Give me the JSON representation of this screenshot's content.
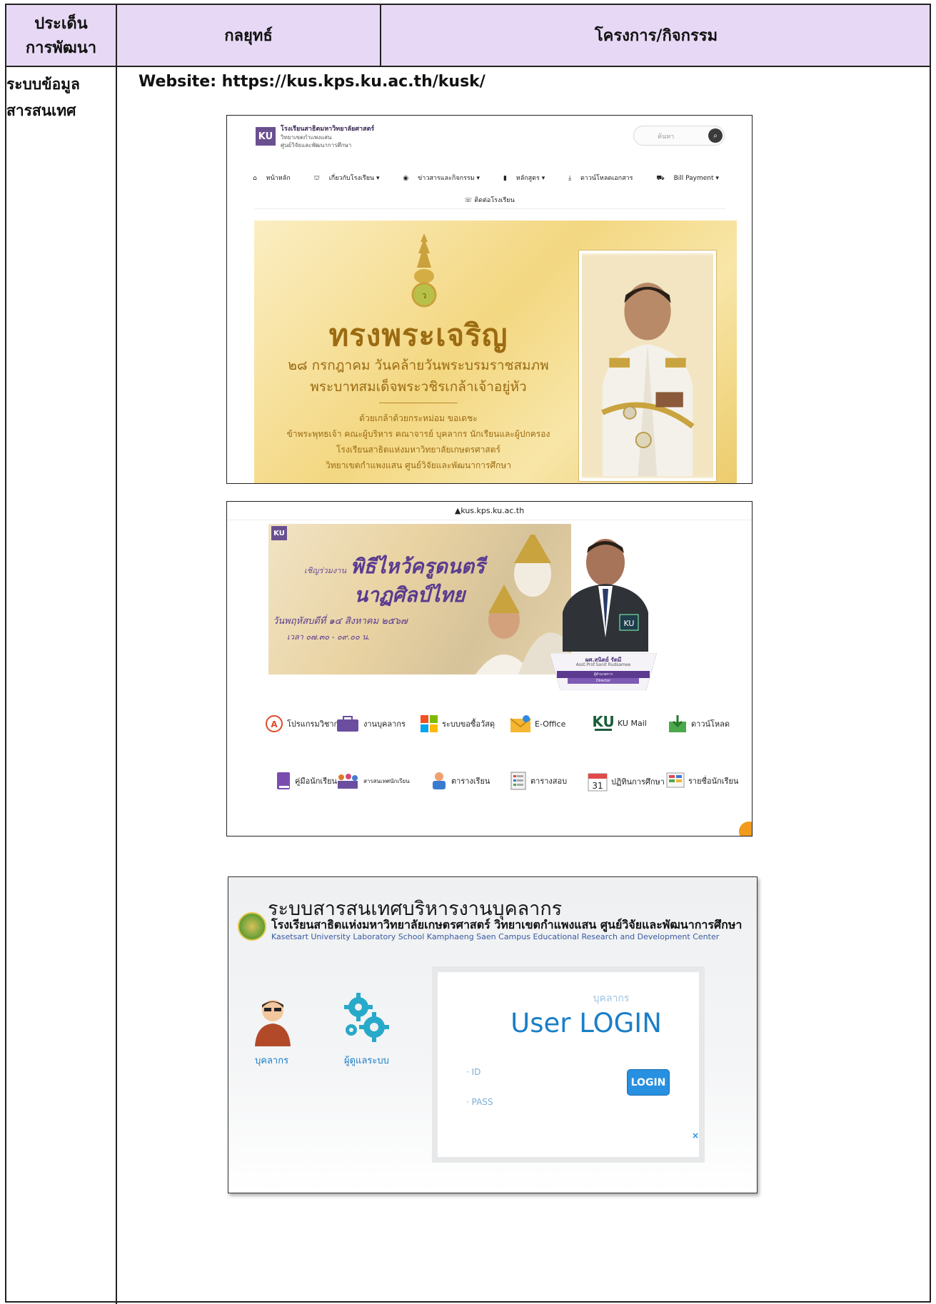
{
  "table": {
    "headers": [
      "ประเด็น\nการพัฒนา",
      "กลยุทธ์",
      "โครงการ/กิจกรรม"
    ],
    "row_label": "ระบบข้อมูล\nสารสนเทศ",
    "website": "Website: https://kus.kps.ku.ac.th/kusk/",
    "header_bg": "#e7d9f5"
  },
  "shot1": {
    "logo": "KU",
    "school_line1": "โรงเรียนสาธิตมหาวิทยาลัยศาสตร์",
    "school_line2": "วิทยาเขตกำแพงแสน",
    "school_line3": "ศูนย์วิจัยและพัฒนาการศึกษา",
    "search_placeholder": "ค้นหา",
    "nav": [
      "หน้าหลัก",
      "เกี่ยวกับโรงเรียน ▾",
      "ข่าวสารและกิจกรรม ▾",
      "หลักสูตร ▾",
      "ดาวน์โหลดเอกสาร",
      "Bill Payment ▾"
    ],
    "nav2": "ติดต่อโรงเรียน",
    "banner_title": "ทรงพระเจริญ",
    "banner_line2": "๒๘ กรกฎาคม วันคล้ายวันพระบรมราชสมภพ",
    "banner_line3": "พระบาทสมเด็จพระวชิรเกล้าเจ้าอยู่หัว",
    "banner_small": [
      "ด้วยเกล้าด้วยกระหม่อม ขอเดชะ",
      "ข้าพระพุทธเจ้า คณะผู้บริหาร คณาจารย์ บุคลากร นักเรียนและผู้ปกครอง",
      "โรงเรียนสาธิตแห่งมหาวิทยาลัยเกษตรศาสตร์",
      "วิทยาเขตกำแพงแสน ศูนย์วิจัยและพัฒนาการศึกษา"
    ]
  },
  "shot2": {
    "url": "▲kus.kps.ku.ac.th",
    "logo": "KU",
    "banner_pre": "เชิญร่วมงาน",
    "banner_title1": "พิธีไหว้ครูดนตรี",
    "banner_title2": "นาฏศิลป์ไทย",
    "banner_date": "วันพฤหัสบดีที่ ๑๔ สิงหาคม ๒๕๖๗",
    "banner_time": "เวลา ๐๗.๓๐ - ๐๙.๐๐ น.",
    "director_name": "ผศ.สนิตย์ รัดมี",
    "director_eng": "Asst.Prof.Sanit Rudsamee",
    "director_role": "ผู้อำนวยการ",
    "director_role_eng": "Director",
    "row1": [
      "โปรแกรมวิชาการ",
      "งานบุคลากร",
      "ระบบขอซื้อวัสดุ",
      "E-Office",
      "KU Mail",
      "ดาวน์โหลด"
    ],
    "row2": [
      "คู่มือนักเรียน",
      "สารสนเทศนักเรียน",
      "ตารางเรียน",
      "ตารางสอบ",
      "ปฏิทินการศึกษา",
      "รายชื่อนักเรียน"
    ],
    "calendar_num": "31"
  },
  "shot3": {
    "title": "ระบบสารสนเทศบริหารงานบุคลากร",
    "subtitle": "โรงเรียนสาธิตแห่งมหาวิทยาลัยเกษตรศาสตร์ วิทยาเขตกำแพงแสน ศูนย์วิจัยและพัฒนาการศึกษา",
    "subtitle_eng": "Kasetsart University Laboratory School Kamphaeng Saen Campus Educational Research and Development Center",
    "personnel_label": "บุคลากร",
    "admin_label": "ผู้ดูแลระบบ",
    "card_caption": "บุคลากร",
    "login_title": "User LOGIN",
    "id_label": "· ID",
    "pass_label": "· PASS",
    "login_button": "LOGIN",
    "close": "×"
  }
}
